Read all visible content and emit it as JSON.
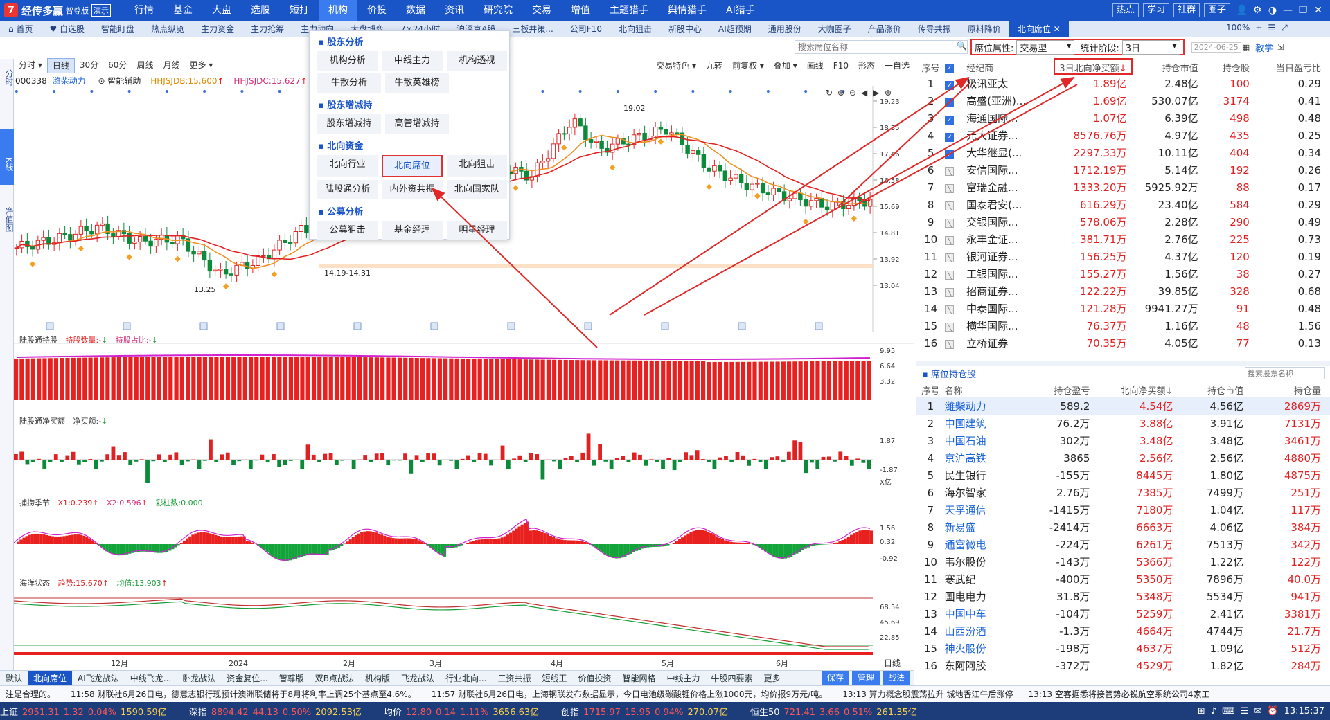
{
  "app": {
    "name": "经传多赢",
    "edition": "智尊版",
    "demo": "演示",
    "logo_mark": "7"
  },
  "menu": [
    {
      "label": "行情"
    },
    {
      "label": "基金"
    },
    {
      "label": "大盘"
    },
    {
      "label": "选股"
    },
    {
      "label": "短打"
    },
    {
      "label": "机构",
      "active": true
    },
    {
      "label": "价投"
    },
    {
      "label": "数据"
    },
    {
      "label": "资讯"
    },
    {
      "label": "研究院"
    },
    {
      "label": "交易",
      "dot": true
    },
    {
      "label": "增值"
    },
    {
      "label": "主题猎手"
    },
    {
      "label": "舆情猎手"
    },
    {
      "label": "AI猎手"
    }
  ],
  "title_buttons": [
    "热点",
    "学习",
    "社群",
    "圈子"
  ],
  "tabs": [
    "首页",
    "自选股",
    "智能盯盘",
    "热点纵览",
    "主力资金",
    "主力抢筹",
    "主力动向",
    "大盘博弈",
    "7×24小时",
    "沪深京A股",
    "三板并策...",
    "公司F10",
    "北向狙击",
    "新股中心",
    "AI超预期",
    "通用股份",
    "大咖圈子",
    "产品涨价",
    "传导共振",
    "原料降价",
    "北向席位"
  ],
  "active_tab": "北向席位",
  "vertical_tabs": [
    "分时",
    "K线",
    "净值图"
  ],
  "chart_toolbar_left": [
    "分时",
    "日线",
    "30分",
    "60分",
    "周线",
    "月线",
    "更多"
  ],
  "chart_toolbar_right": [
    "交易特色",
    "九转",
    "前复权",
    "叠加",
    "画线",
    "F10",
    "形态",
    "一自选"
  ],
  "stock": {
    "code": "000338",
    "name": "潍柴动力",
    "indicator": "智能辅助",
    "hh1": "HHJSJDB:15.600",
    "hh2": "HHJSJDC:15.627"
  },
  "price_axis": [
    "19.23",
    "18.35",
    "17.46",
    "16.58",
    "15.69",
    "14.81",
    "13.92",
    "13.04"
  ],
  "annotations": {
    "high": "19.02",
    "low": "13.25",
    "range": "14.19-14.31"
  },
  "month_axis": [
    "12月",
    "2024",
    "2月",
    "3月",
    "4月",
    "5月",
    "6月"
  ],
  "period_label": "日线",
  "panels": {
    "p1": {
      "name": "陆股通持股",
      "f1": "持股数量:-",
      "f2": "持股占比:-",
      "axis": [
        "9.95",
        "6.64",
        "3.32"
      ]
    },
    "p2": {
      "name": "陆股通净买额",
      "f1": "净买额:-",
      "axis": [
        "1.87",
        "-1.87",
        "X亿"
      ]
    },
    "p3": {
      "name": "捕捞季节",
      "f1": "X1:0.239",
      "f2": "X2:0.596",
      "f3": "彩柱数:0.000",
      "axis": [
        "1.56",
        "0.32",
        "-0.92"
      ]
    },
    "p4": {
      "name": "海洋状态",
      "f1": "趋势:15.670",
      "f2": "均值:13.903",
      "axis": [
        "68.54",
        "45.69",
        "22.85"
      ]
    }
  },
  "dropdown": {
    "sections": [
      {
        "title": "股东分析",
        "rows": [
          [
            "机构分析",
            "中线主力",
            "机构透视"
          ],
          [
            "牛散分析",
            "牛散英雄榜"
          ]
        ]
      },
      {
        "title": "股东增减持",
        "rows": [
          [
            "股东增减持",
            "高管增减持"
          ]
        ]
      },
      {
        "title": "北向资金",
        "rows": [
          [
            "北向行业",
            "北向席位",
            "北向狙击"
          ],
          [
            "陆股通分析",
            "内外资共振",
            "北向国家队"
          ]
        ]
      },
      {
        "title": "公募分析",
        "rows": [
          [
            "公募狙击",
            "基金经理",
            "明星经理"
          ]
        ]
      }
    ],
    "selected": "北向席位"
  },
  "search_seat_placeholder": "搜索席位名称",
  "filter": {
    "attr_label": "席位属性:",
    "attr_value": "交易型",
    "period_label": "统计阶段:",
    "period_value": "3日",
    "date": "2024-06-25",
    "teach": "教学"
  },
  "zoom": "100%",
  "seat_table": {
    "headers": [
      "序号",
      "",
      "经纪商",
      "3日北向净买额",
      "持仓市值",
      "持仓股",
      "当日盈亏比"
    ],
    "rows": [
      [
        "1",
        "极讯亚太",
        "1.89亿",
        "2.48亿",
        "100",
        "0.29"
      ],
      [
        "2",
        "高盛(亚洲)...",
        "1.69亿",
        "530.07亿",
        "3174",
        "0.41"
      ],
      [
        "3",
        "海通国际...",
        "1.07亿",
        "6.39亿",
        "498",
        "0.48"
      ],
      [
        "4",
        "元大证券...",
        "8576.76万",
        "4.97亿",
        "435",
        "0.25"
      ],
      [
        "5",
        "大华继显(...",
        "2297.33万",
        "10.11亿",
        "404",
        "0.34"
      ],
      [
        "6",
        "安信国际...",
        "1712.19万",
        "5.14亿",
        "192",
        "0.26"
      ],
      [
        "7",
        "富瑞金融...",
        "1333.20万",
        "5925.92万",
        "88",
        "0.17"
      ],
      [
        "8",
        "国泰君安(...",
        "616.29万",
        "23.40亿",
        "584",
        "0.29"
      ],
      [
        "9",
        "交银国际...",
        "578.06万",
        "2.28亿",
        "290",
        "0.49"
      ],
      [
        "10",
        "永丰金证...",
        "381.71万",
        "2.76亿",
        "225",
        "0.73"
      ],
      [
        "11",
        "银河证券...",
        "156.25万",
        "4.37亿",
        "120",
        "0.19"
      ],
      [
        "12",
        "工银国际...",
        "155.27万",
        "1.56亿",
        "38",
        "0.27"
      ],
      [
        "13",
        "招商证券...",
        "122.22万",
        "39.85亿",
        "328",
        "0.68"
      ],
      [
        "14",
        "中泰国际...",
        "121.28万",
        "9941.27万",
        "91",
        "0.48"
      ],
      [
        "15",
        "横华国际...",
        "76.37万",
        "1.16亿",
        "48",
        "1.56"
      ],
      [
        "16",
        "立桥证券",
        "70.35万",
        "4.05亿",
        "77",
        "0.13"
      ]
    ]
  },
  "holdings": {
    "title": "席位持仓股",
    "search_placeholder": "搜索股票名称",
    "headers": [
      "序号",
      "名称",
      "持仓盈亏",
      "北向净买额↓",
      "持仓市值",
      "持仓量"
    ],
    "rows": [
      [
        "1",
        "潍柴动力",
        "589.2",
        "4.54亿",
        "4.56亿",
        "2869万"
      ],
      [
        "2",
        "中国建筑",
        "76.2万",
        "3.88亿",
        "3.91亿",
        "7131万"
      ],
      [
        "3",
        "中国石油",
        "302万",
        "3.48亿",
        "3.48亿",
        "3461万"
      ],
      [
        "4",
        "京沪高铁",
        "3865",
        "2.56亿",
        "2.56亿",
        "4880万"
      ],
      [
        "5",
        "民生银行",
        "-155万",
        "8445万",
        "1.80亿",
        "4875万"
      ],
      [
        "6",
        "海尔智家",
        "2.76万",
        "7385万",
        "7499万",
        "251万"
      ],
      [
        "7",
        "天孚通信",
        "-1415万",
        "7180万",
        "1.04亿",
        "117万"
      ],
      [
        "8",
        "新易盛",
        "-2414万",
        "6663万",
        "4.06亿",
        "384万"
      ],
      [
        "9",
        "通富微电",
        "-224万",
        "6261万",
        "7513万",
        "342万"
      ],
      [
        "10",
        "韦尔股份",
        "-143万",
        "5366万",
        "1.22亿",
        "122万"
      ],
      [
        "11",
        "寒武纪",
        "-400万",
        "5350万",
        "7896万",
        "40.0万"
      ],
      [
        "12",
        "国电电力",
        "31.8万",
        "5348万",
        "5534万",
        "941万"
      ],
      [
        "13",
        "中国中车",
        "-104万",
        "5259万",
        "2.41亿",
        "3381万"
      ],
      [
        "14",
        "山西汾酒",
        "-1.3万",
        "4664万",
        "4744万",
        "21.7万"
      ],
      [
        "15",
        "神火股份",
        "-198万",
        "4637万",
        "1.09亿",
        "512万"
      ],
      [
        "16",
        "东阿阿胶",
        "-372万",
        "4529万",
        "1.82亿",
        "284万"
      ]
    ],
    "blue_names": [
      "潍柴动力",
      "中国建筑",
      "中国石油",
      "京沪高铁",
      "天孚通信",
      "新易盛",
      "通富微电",
      "中国中车",
      "山西汾酒",
      "神火股份"
    ]
  },
  "bottom_tabs": [
    "默认",
    "北向席位",
    "AI飞龙战法",
    "中线飞龙...",
    "卧龙战法",
    "资金复位...",
    "智尊版",
    "双B点战法",
    "机构版",
    "飞龙战法",
    "行业北向...",
    "三资共振",
    "短线王",
    "价值投资",
    "智能网格",
    "中线主力",
    "牛股四要素",
    "更多"
  ],
  "bottom_right": [
    "保存",
    "管理",
    "战法"
  ],
  "news": [
    "注是合理的。",
    "11:58 财联社6月26日电，德意志银行现预计澳洲联储将于8月将利率上调25个基点至4.6%。",
    "11:57 财联社6月26日电，上海钢联发布数据显示，今日电池级碳酸锂价格上涨1000元，均价报9万元/吨。",
    "13:13 算力概念股震荡拉升 城地香江午后涨停",
    "13:13 空客据悉将接管势必锐航空系统公司4家工"
  ],
  "status": {
    "sh": {
      "label": "上证",
      "value": "2951.31",
      "chg": "1.32",
      "pct": "0.04%",
      "amt": "1590.59亿"
    },
    "sz": {
      "label": "深指",
      "value": "8894.42",
      "chg": "44.13",
      "pct": "0.50%",
      "amt": "2092.53亿"
    },
    "avg": {
      "label": "均价",
      "value": "12.80",
      "chg": "0.14",
      "pct": "1.11%",
      "amt": "3656.63亿"
    },
    "cy": {
      "label": "创指",
      "value": "1715.97",
      "chg": "15.95",
      "pct": "0.94%",
      "amt": "270.07亿"
    },
    "hs": {
      "label": "恒生50",
      "value": "721.41",
      "chg": "3.66",
      "pct": "0.51%",
      "amt": "261.35亿"
    },
    "time": "13:15:37"
  }
}
